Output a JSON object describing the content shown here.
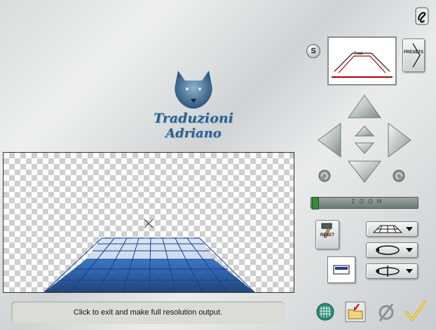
{
  "status_bar": {
    "message": "Click to exit and make full resolution output."
  },
  "watermark": {
    "line1": "Traduzioni",
    "line2": "Adriano"
  },
  "presets": {
    "label": "PRESETS",
    "s_badge": "S"
  },
  "reset": {
    "label": "RESET"
  },
  "zoom": {
    "label": "Z O O M"
  },
  "preview_thumb": {
    "text": "Trad"
  },
  "colors": {
    "grid_blue": "#1d3b8f",
    "floor_blue": "#2b67b8",
    "logo_blue": "#2c5f8c"
  }
}
